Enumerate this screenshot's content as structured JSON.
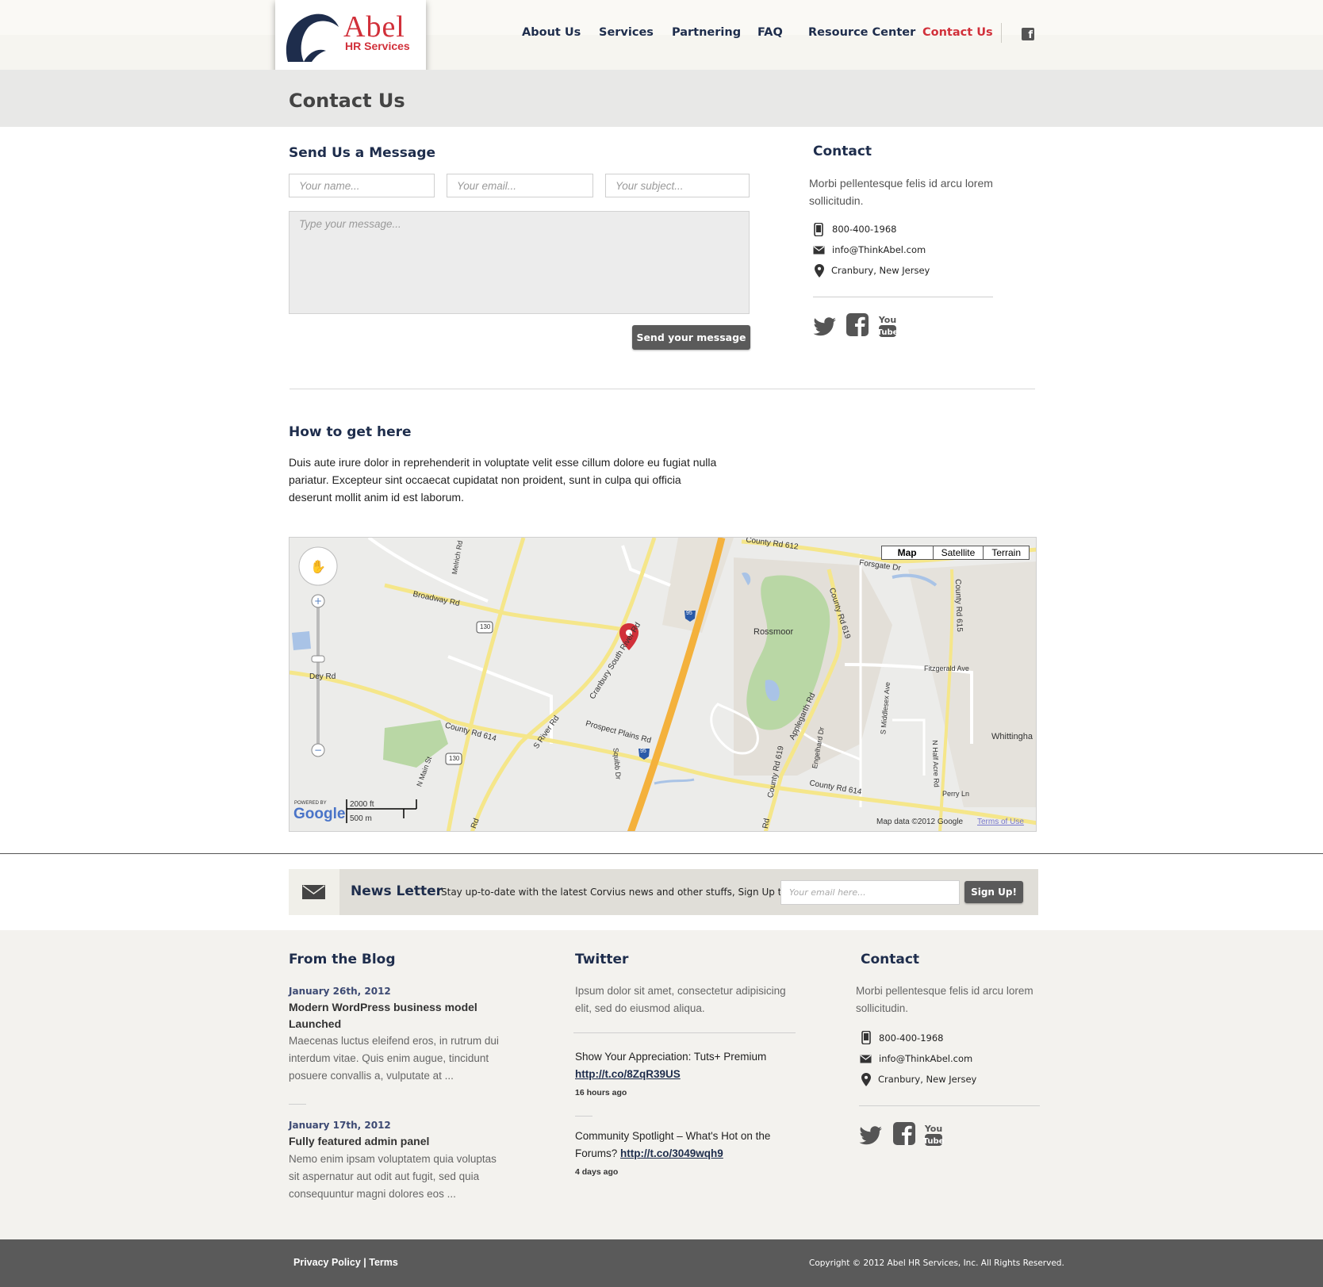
{
  "brand": {
    "name": "Abel",
    "tagline": "HR Services",
    "color": "#d1303a",
    "navy": "#1e2d4c"
  },
  "nav": {
    "items": [
      "About Us",
      "Services",
      "Partnering",
      "FAQ",
      "Resource Center",
      "Contact Us"
    ],
    "active": "Contact Us",
    "social_icon": "facebook-icon"
  },
  "page": {
    "title": "Contact Us"
  },
  "form": {
    "heading": "Send Us a Message",
    "name_placeholder": "Your name...",
    "email_placeholder": "Your email...",
    "subject_placeholder": "Your subject...",
    "message_placeholder": "Type your message...",
    "submit_label": "Send your message"
  },
  "contact": {
    "heading": "Contact",
    "intro": "Morbi pellentesque felis id arcu lorem sollicitudin.",
    "phone": "800-400-1968",
    "email": "info@ThinkAbel.com",
    "location": "Cranbury, New Jersey",
    "social": [
      "twitter-icon",
      "facebook-icon",
      "youtube-icon"
    ]
  },
  "directions": {
    "heading": "How to get here",
    "text": "Duis aute irure dolor in reprehenderit in voluptate velit esse cillum dolore eu fugiat nulla pariatur. Excepteur sint occaecat cupidatat non proident, sunt in culpa qui officia deserunt mollit anim id est laborum."
  },
  "map": {
    "types": [
      "Map",
      "Satellite",
      "Terrain"
    ],
    "selected_type": "Map",
    "labels": {
      "broadway": "Broadway Rd",
      "cranbury_south_river": "Cranbury South River Rd",
      "county_614": "County Rd 614",
      "county_614_b": "County Rd 614",
      "county_612": "County Rd 612",
      "county_619": "County Rd 619",
      "county_619_b": "County Rd 619",
      "county_615": "County Rd 615",
      "s_river": "S River Rd",
      "prospect_plains": "Prospect Plains Rd",
      "forsgate": "Forsgate Dr",
      "applegarth": "Applegarth Rd",
      "rossmoor": "Rossmoor",
      "fitzgerald": "Fitzgerald Ave",
      "s_middlesex": "S Middlesex Ave",
      "engelhard": "Engelhard Dr",
      "n_half_acre": "N Half Acre Rd",
      "whittingham": "Whittingha",
      "perry": "Perry Ln",
      "n_main": "N Main St",
      "squibb": "Squibb Dr",
      "melrich": "Melrich Rd",
      "dey": "Dey Rd",
      "rt130": "130",
      "rt130_b": "130",
      "i95": "95",
      "i95_b": "95",
      "rd_bottom": "Rd",
      "rd_bottom_b": "Rd"
    },
    "powered_by": "POWERED BY",
    "google": "Google",
    "scale_ft": "2000 ft",
    "scale_m": "500 m",
    "attribution": "Map data ©2012 Google",
    "terms": "Terms of Use",
    "marker_color": "#d1303a"
  },
  "newsletter": {
    "title": "News Letter",
    "text": "Stay up-to-date with the latest Corvius news and other stuffs, Sign Up today!",
    "placeholder": "Your email here...",
    "button": "Sign Up!"
  },
  "footer": {
    "blog": {
      "heading": "From the Blog",
      "posts": [
        {
          "date": "January 26th, 2012",
          "title": "Modern WordPress business model Launched",
          "excerpt": "Maecenas luctus eleifend eros, in rutrum dui interdum vitae. Quis enim augue, tincidunt posuere convallis a, vulputate at ..."
        },
        {
          "date": "January 17th, 2012",
          "title": "Fully featured admin panel",
          "excerpt": "Nemo enim ipsam voluptatem quia voluptas sit aspernatur aut odit aut fugit, sed quia consequuntur magni dolores eos ..."
        }
      ]
    },
    "twitter": {
      "heading": "Twitter",
      "intro": "Ipsum dolor sit amet, consectetur adipisicing elit, sed do eiusmod aliqua.",
      "tweets": [
        {
          "text": "Show Your Appreciation: Tuts+ Premium",
          "link": "http://t.co/8ZqR39US",
          "time": "16 hours ago"
        },
        {
          "text": "Community Spotlight – What's Hot on the Forums?",
          "link": "http://t.co/3049wqh9",
          "time": "4 days ago"
        }
      ]
    },
    "contact": {
      "heading": "Contact",
      "intro": "Morbi pellentesque felis id arcu lorem sollicitudin.",
      "phone": "800-400-1968",
      "email": "info@ThinkAbel.com",
      "location": "Cranbury, New Jersey"
    }
  },
  "bottom": {
    "privacy": "Privacy Policy",
    "separator": "|",
    "terms": "Terms",
    "copyright": "Copyright © 2012 Abel HR Services, Inc. All Rights Reserved."
  }
}
